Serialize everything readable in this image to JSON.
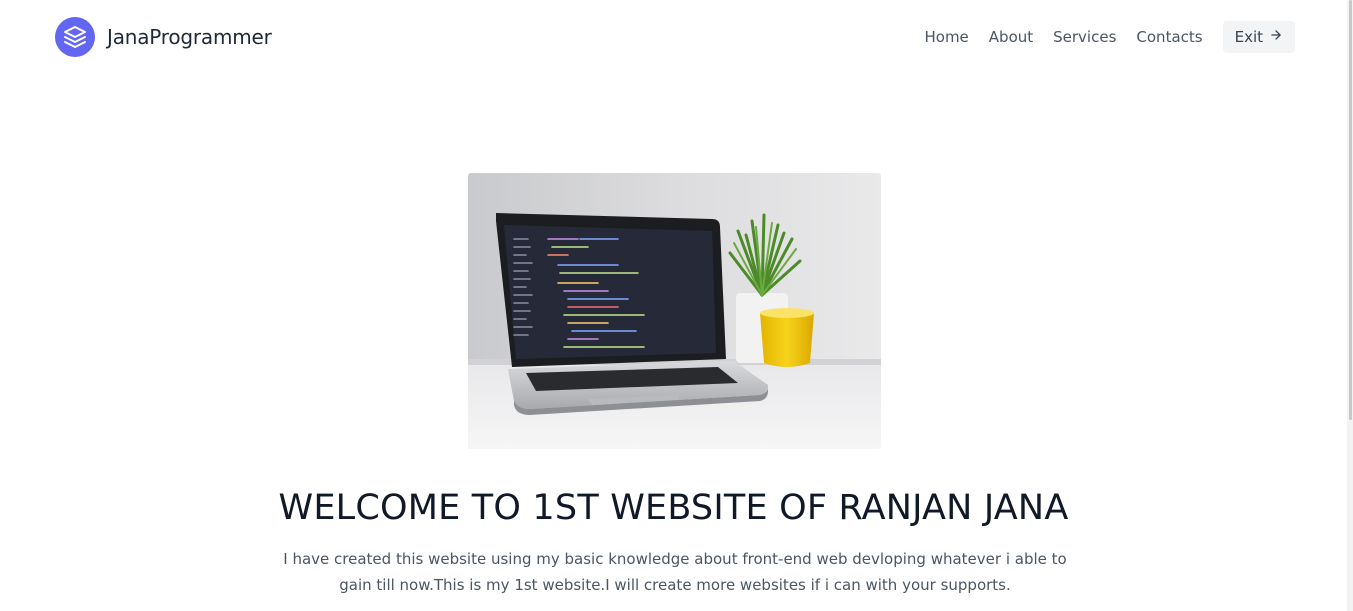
{
  "header": {
    "brand_name": "JanaProgrammer",
    "logo_icon": "layers-icon",
    "nav": [
      {
        "label": "Home"
      },
      {
        "label": "About"
      },
      {
        "label": "Services"
      },
      {
        "label": "Contacts"
      }
    ],
    "exit_label": "Exit",
    "exit_icon": "arrow-right-icon"
  },
  "hero": {
    "image": "laptop-on-desk-with-code-editor-and-plant",
    "title": "WELCOME TO 1ST WEBSITE OF RANJAN JANA",
    "text": "I have created this website using my basic knowledge about front-end web devloping whatever i able to gain till now.This is my 1st website.I will create more websites if i can with your supports."
  },
  "colors": {
    "accent": "#6366f1",
    "heading": "#111827",
    "body_text": "#4b5563",
    "button_bg": "#f3f4f6"
  }
}
